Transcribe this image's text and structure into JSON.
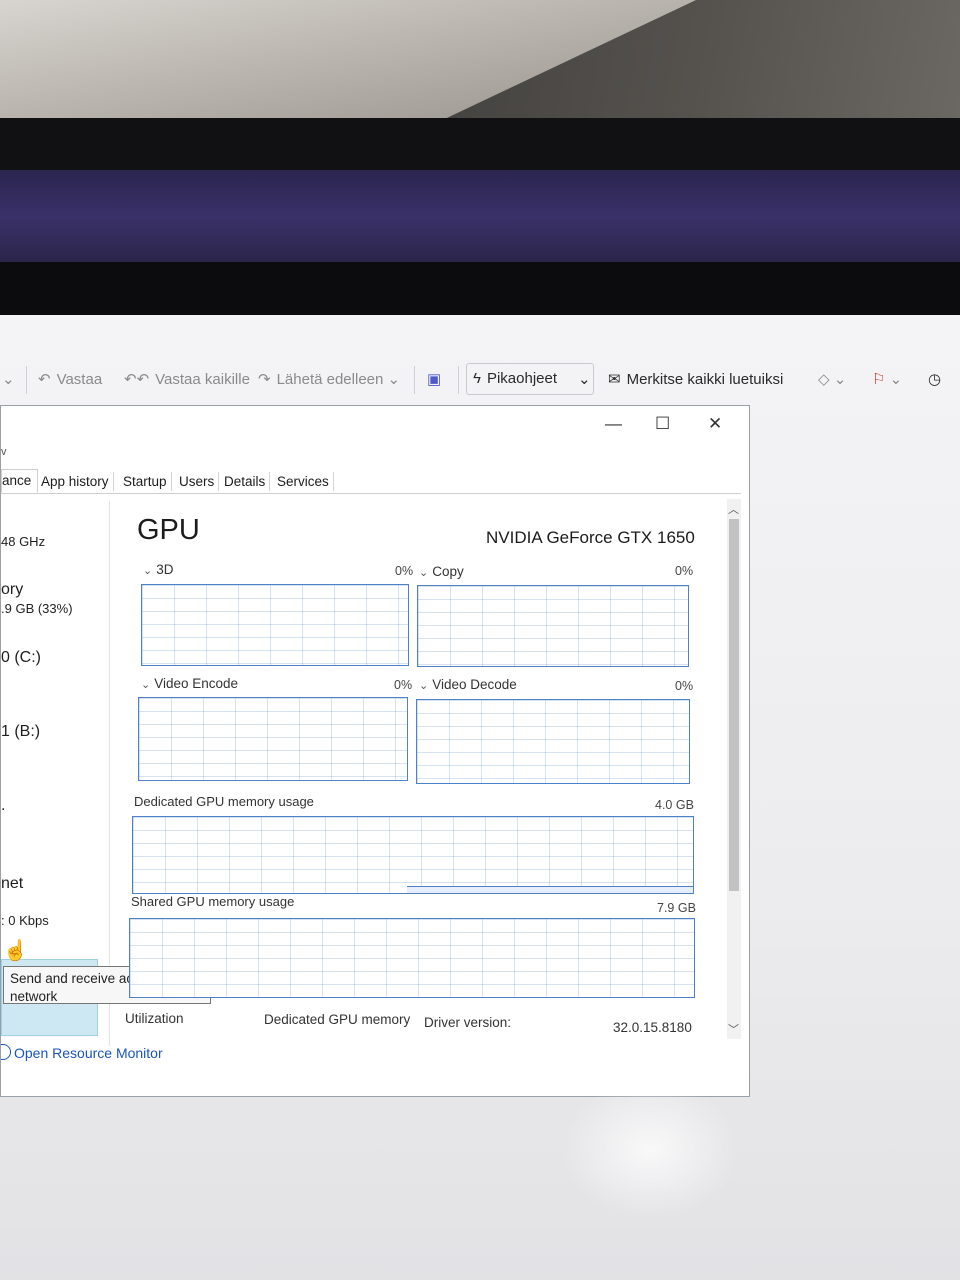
{
  "outlook_toolbar": {
    "reply_label": "Vastaa",
    "reply_all_label": "Vastaa kaikille",
    "forward_label": "Lähetä edelleen",
    "quick_steps_label": "Pikaohjeet",
    "mark_all_read_label": "Merkitse kaikki luetuiksi"
  },
  "task_manager": {
    "tabs": [
      "ance",
      "App history",
      "Startup",
      "Users",
      "Details",
      "Services"
    ],
    "left_panel": {
      "cpu_speed": "48 GHz",
      "memory_label": "ory",
      "memory_value": ".9 GB (33%)",
      "disk_c": "0 (C:)",
      "disk_b": "1 (B:)",
      "network_label": "net",
      "network_value": ": 0 Kbps"
    },
    "gpu": {
      "title": "GPU",
      "model": "NVIDIA GeForce GTX 1650",
      "engines": [
        {
          "label": "3D",
          "percent": "0%"
        },
        {
          "label": "Copy",
          "percent": "0%"
        },
        {
          "label": "Video Encode",
          "percent": "0%"
        },
        {
          "label": "Video Decode",
          "percent": "0%"
        }
      ],
      "dedicated_label": "Dedicated GPU memory usage",
      "dedicated_max": "4.0 GB",
      "dedicated_usage_fraction": 0.03,
      "shared_label": "Shared GPU memory usage",
      "shared_max": "7.9 GB",
      "stats": {
        "utilization_label": "Utilization",
        "dedicated_memory_label": "Dedicated GPU memory",
        "driver_version_label": "Driver version:",
        "driver_version_value": "32.0.15.8180"
      }
    },
    "tooltip_text": "Send and receive activity on this network",
    "open_resource_monitor": "Open Resource Monitor"
  }
}
